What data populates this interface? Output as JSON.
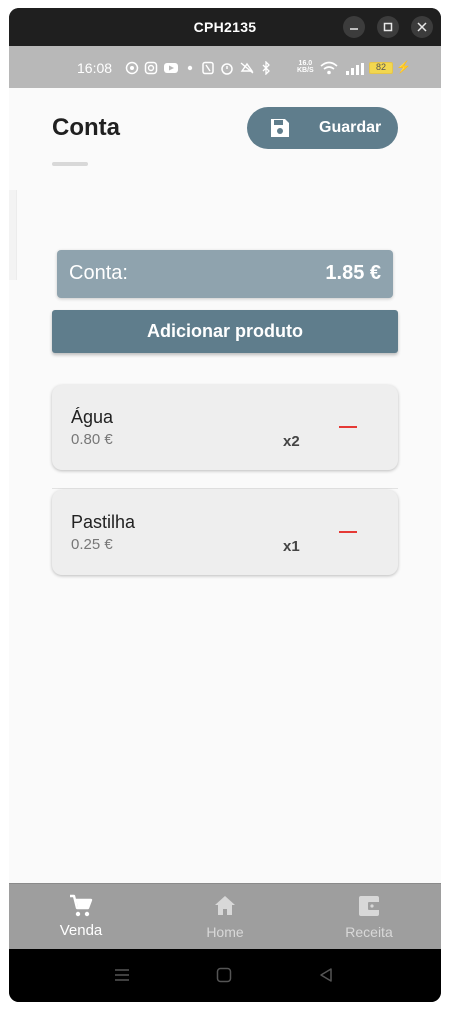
{
  "window": {
    "title": "CPH2135"
  },
  "statusbar": {
    "time": "16:08",
    "netspeed_value": "16.0",
    "netspeed_unit": "KB/S",
    "battery": "82"
  },
  "header": {
    "title": "Conta",
    "save_label": "Guardar"
  },
  "total": {
    "label": "Conta:",
    "value": "1.85 €"
  },
  "actions": {
    "add_product_label": "Adicionar produto"
  },
  "items": [
    {
      "name": "Água",
      "price": "0.80 €",
      "qty": "x2"
    },
    {
      "name": "Pastilha",
      "price": "0.25 €",
      "qty": "x1"
    }
  ],
  "nav": {
    "active": "Venda",
    "items": [
      {
        "label": "Venda",
        "icon": "cart-icon"
      },
      {
        "label": "Home",
        "icon": "home-icon"
      },
      {
        "label": "Receita",
        "icon": "wallet-icon"
      }
    ]
  },
  "colors": {
    "primary": "#5f7d8c",
    "total_bg": "#8fa3ae",
    "remove": "#e53935",
    "nav_bg": "#9e9e9e"
  }
}
